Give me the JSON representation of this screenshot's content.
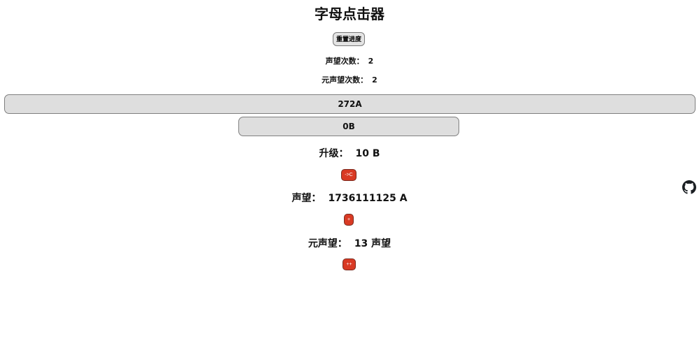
{
  "title": "字母点击器",
  "reset_button": "重置进度",
  "stats": {
    "prestige_count_label": "声望次数：",
    "prestige_count_value": "2",
    "meta_prestige_count_label": "元声望次数：",
    "meta_prestige_count_value": "2"
  },
  "bars": {
    "a_label": "272A",
    "b_label": "0B"
  },
  "upgrade": {
    "label": "升级：",
    "value": "10 B",
    "button": "->C"
  },
  "prestige": {
    "label": "声望：",
    "value": "1736111125 A",
    "button": "+"
  },
  "meta_prestige": {
    "label": "元声望：",
    "value": "13 声望",
    "button": "++"
  },
  "icons": {
    "github": "github-icon"
  },
  "colors": {
    "button_red": "#d93a24",
    "bar_gray": "#dedede"
  }
}
